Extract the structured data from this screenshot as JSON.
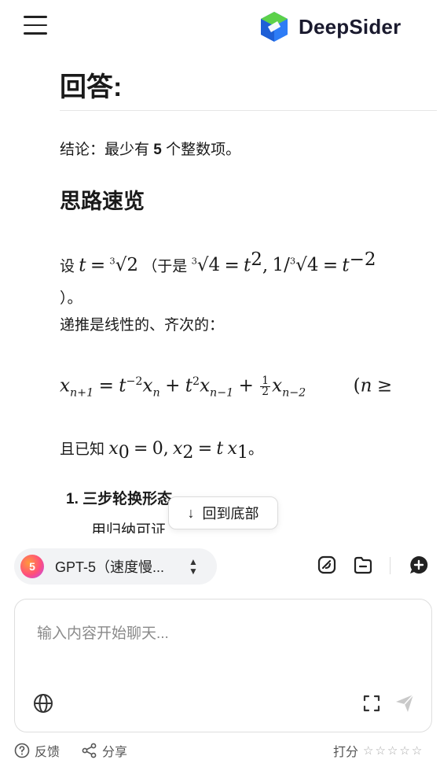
{
  "app": {
    "name": "DeepSider"
  },
  "content": {
    "title": "回答:",
    "conclusion_prefix": "结论：最少有 ",
    "conclusion_number": "5",
    "conclusion_suffix": " 个整数项。",
    "section_heading": "思路速览",
    "let_prefix": "设 ",
    "let_paren_prefix": "（于是 ",
    "let_close": "）。",
    "recurrence_desc": "递推是线性的、齐次的：",
    "known_prefix": "且已知 ",
    "known_suffix": "。",
    "list": [
      {
        "number": "1.",
        "heading": "三步轮换形态",
        "body": "用归纳可证"
      }
    ]
  },
  "scroll_to_bottom": {
    "label": "回到底部"
  },
  "model_selector": {
    "badge": "5",
    "name": "GPT-5（速度慢..."
  },
  "toolbar_icons": [
    "sticker-icon",
    "folder-icon",
    "new-chat-icon"
  ],
  "chat_input": {
    "placeholder": "输入内容开始聊天..."
  },
  "footer": {
    "feedback_label": "反馈",
    "share_label": "分享",
    "rate_label": "打分",
    "stars": [
      "☆",
      "☆",
      "☆",
      "☆",
      "☆"
    ]
  }
}
